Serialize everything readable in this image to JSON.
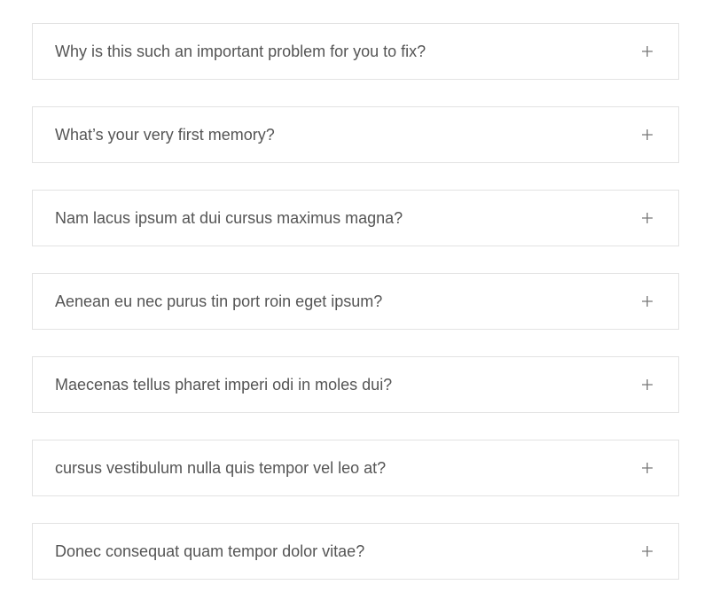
{
  "faq": {
    "items": [
      {
        "question": "Why is this such an important problem for you to fix?",
        "expanded": false,
        "icon": "plus-icon"
      },
      {
        "question": "What’s your very first memory?",
        "expanded": false,
        "icon": "plus-icon"
      },
      {
        "question": "Nam lacus ipsum at dui cursus maximus magna?",
        "expanded": false,
        "icon": "plus-icon"
      },
      {
        "question": "Aenean eu nec purus tin port roin eget ipsum?",
        "expanded": false,
        "icon": "plus-icon"
      },
      {
        "question": "Maecenas tellus pharet imperi odi in moles dui?",
        "expanded": false,
        "icon": "plus-icon"
      },
      {
        "question": "cursus vestibulum nulla quis tempor vel leo at?",
        "expanded": false,
        "icon": "plus-icon"
      },
      {
        "question": "Donec consequat quam tempor dolor vitae?",
        "expanded": false,
        "icon": "plus-icon"
      }
    ],
    "colors": {
      "text": "#555555",
      "border": "#e3e3e3",
      "icon": "#777777",
      "background": "#ffffff"
    }
  }
}
